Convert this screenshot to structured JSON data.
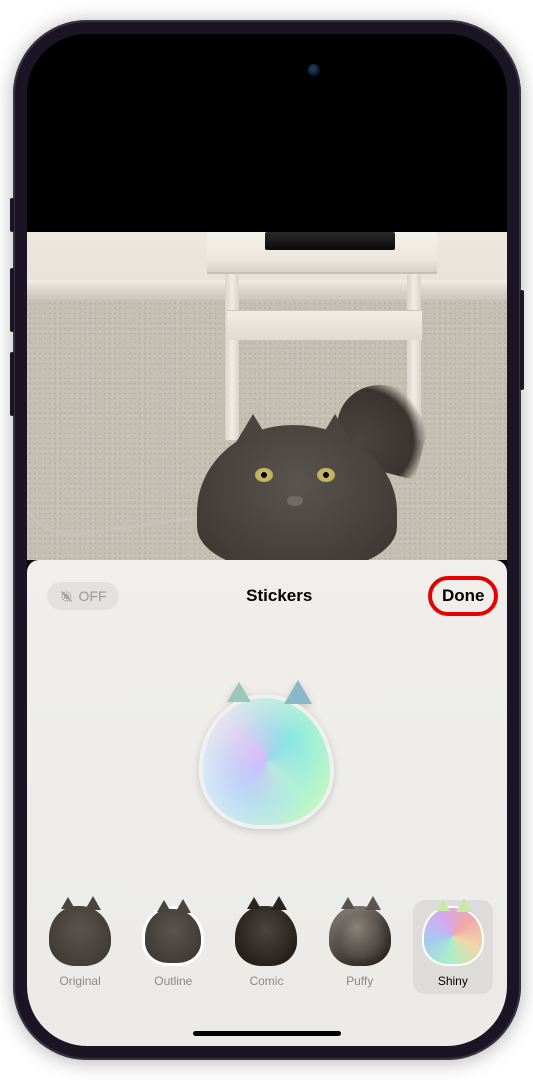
{
  "panel": {
    "title": "Stickers",
    "done_label": "Done",
    "off_label": "OFF"
  },
  "effects": [
    {
      "id": "original",
      "label": "Original"
    },
    {
      "id": "outline",
      "label": "Outline"
    },
    {
      "id": "comic",
      "label": "Comic"
    },
    {
      "id": "puffy",
      "label": "Puffy"
    },
    {
      "id": "shiny",
      "label": "Shiny"
    }
  ],
  "selected_effect": "shiny",
  "highlight": {
    "target": "done-button",
    "color": "#e60000"
  }
}
